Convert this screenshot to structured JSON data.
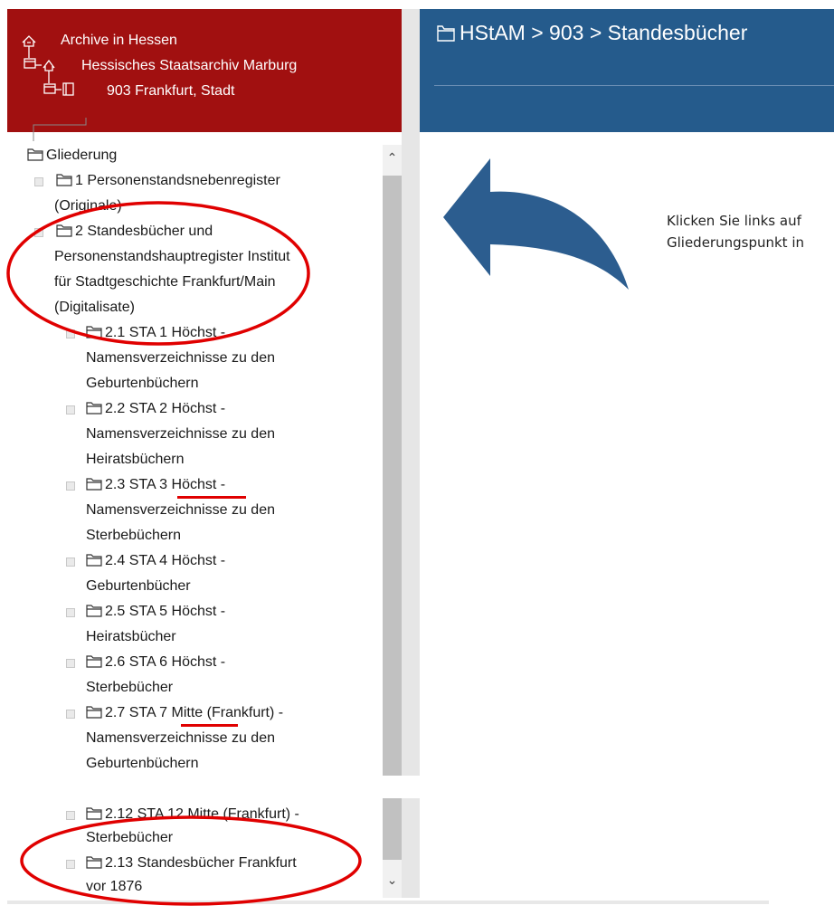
{
  "header_left": {
    "root": "Archive in Hessen",
    "archive": "Hessisches Staatsarchiv Marburg",
    "fonds": "903 Frankfurt, Stadt"
  },
  "header_right": {
    "breadcrumb": "HStAM > 903 > Standesbücher"
  },
  "tree": {
    "root_label": "Gliederung",
    "items": [
      {
        "lines": [
          "1 Personenstandsnebenregister",
          "(Originale)"
        ]
      },
      {
        "lines": [
          "2 Standesbücher und",
          "Personenstandshauptregister Institut",
          "für Stadtgeschichte Frankfurt/Main",
          "(Digitalisate)"
        ]
      },
      {
        "lines": [
          "2.1 STA 1 Höchst -",
          "Namensverzeichnisse zu den",
          "Geburtenbüchern"
        ]
      },
      {
        "lines": [
          "2.2 STA 2 Höchst -",
          "Namensverzeichnisse zu den",
          "Heiratsbüchern"
        ]
      },
      {
        "lines": [
          "2.3 STA 3 Höchst -",
          "Namensverzeichnisse zu den",
          "Sterbebüchern"
        ]
      },
      {
        "lines": [
          "2.4 STA 4 Höchst -",
          "Geburtenbücher"
        ]
      },
      {
        "lines": [
          "2.5 STA 5 Höchst -",
          "Heiratsbücher"
        ]
      },
      {
        "lines": [
          "2.6 STA 6 Höchst -",
          "Sterbebücher"
        ]
      },
      {
        "lines": [
          "2.7 STA 7 Mitte (Frankfurt) -",
          "Namensverzeichnisse zu den",
          "Geburtenbüchern"
        ]
      },
      {
        "lines": [
          "2.12 STA 12 Mitte (Frankfurt) -",
          "Sterbebücher"
        ]
      },
      {
        "lines": [
          "2.13 Standesbücher Frankfurt",
          "vor 1876"
        ]
      }
    ]
  },
  "instruction": {
    "line1": "Klicken Sie links auf",
    "line2": "Gliederungspunkt in"
  },
  "icons": [
    "archive-home-icon",
    "building-icon",
    "book-icon",
    "folder-icon",
    "arrow-back-icon",
    "scroll-up-icon",
    "scroll-down-icon",
    "expand-icon",
    "collapse-icon"
  ],
  "colors": {
    "header_red": "#a11010",
    "header_blue": "#255b8c",
    "arrow_blue": "#2c5d8f",
    "annotation_red": "#e00000"
  }
}
